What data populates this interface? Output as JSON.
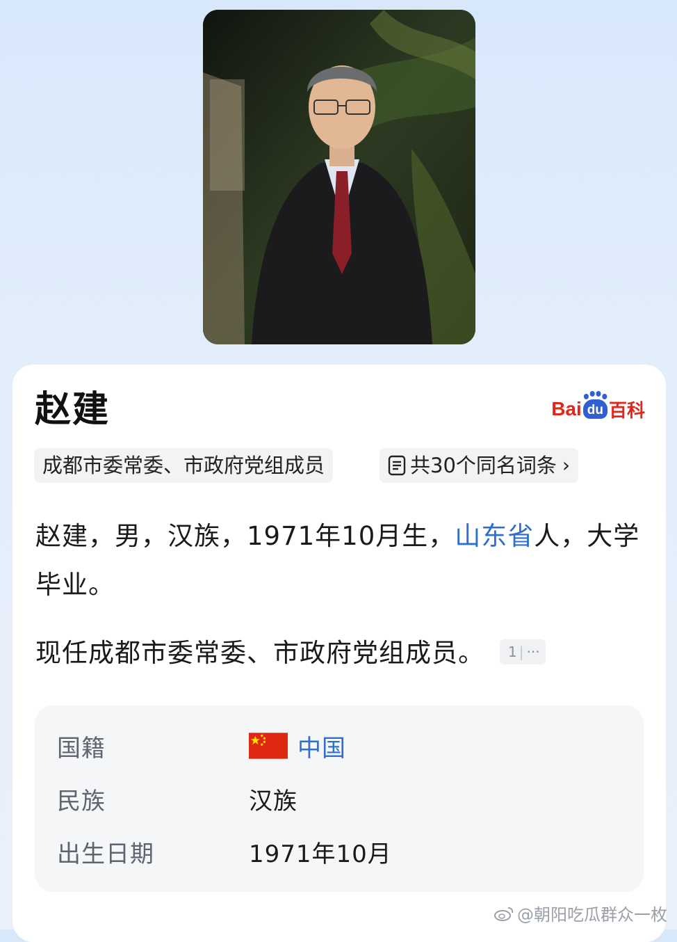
{
  "person": {
    "name": "赵建",
    "description_tag": "成都市委常委、市政府党组成员",
    "same_name_link": "共30个同名词条",
    "summary_part1": "赵建，男，汉族，1971年10月生，",
    "summary_place": "山东省",
    "summary_part2": "人，大学毕业。",
    "current_post": "现任成都市委常委、市政府党组成员。",
    "citation": "1"
  },
  "logo": {
    "bai": "Bai",
    "du": "du",
    "baike": "百科",
    "brand_red": "#e0261d",
    "brand_blue": "#2f5fd0"
  },
  "infobox": [
    {
      "key": "国籍",
      "value": "中国"
    },
    {
      "key": "民族",
      "value": "汉族"
    },
    {
      "key": "出生日期",
      "value": "1971年10月"
    }
  ],
  "watermark": "@朝阳吃瓜群众一枚",
  "colors": {
    "link": "#2f6fc8",
    "background": "#e3eefb"
  }
}
